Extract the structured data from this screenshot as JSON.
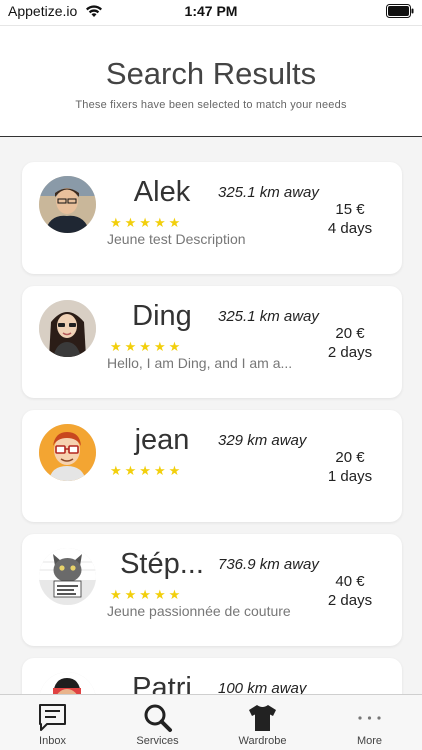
{
  "status_bar": {
    "carrier": "Appetize.io",
    "time": "1:47 PM"
  },
  "header": {
    "title": "Search Results",
    "subtitle": "These fixers have been selected to match your needs"
  },
  "results": [
    {
      "name": "Alek",
      "distance": "325.1 km away",
      "rating": "★★★★★",
      "description": "Jeune test Description",
      "price": "15 €",
      "duration": "4 days",
      "avatar_icon": "man-portrait-icon"
    },
    {
      "name": "Ding",
      "distance": "325.1 km away",
      "rating": "★★★★★",
      "description": "Hello, I am Ding, and  I am a...",
      "price": "20 €",
      "duration": "2 days",
      "avatar_icon": "woman-portrait-icon"
    },
    {
      "name": "jean",
      "distance": "329 km away",
      "rating": "★★★★★",
      "description": "",
      "price": "20 €",
      "duration": "1 days",
      "avatar_icon": "cartoon-man-icon"
    },
    {
      "name": "Stép...",
      "distance": "736.9 km away",
      "rating": "★★★★★",
      "description": "Jeune passionnée de couture",
      "price": "40 €",
      "duration": "2 days",
      "avatar_icon": "cat-portrait-icon"
    },
    {
      "name": "Patri",
      "distance": "100 km away",
      "rating": "",
      "description": "",
      "price": "",
      "duration": "",
      "avatar_icon": "person-avatar-icon"
    }
  ],
  "tab_bar": {
    "tabs": [
      {
        "label": "Inbox",
        "icon": "inbox-icon"
      },
      {
        "label": "Services",
        "icon": "search-icon"
      },
      {
        "label": "Wardrobe",
        "icon": "tshirt-icon"
      },
      {
        "label": "More",
        "icon": "more-dots-icon"
      }
    ]
  },
  "colors": {
    "star": "#f2cf0c",
    "background_list": "#f4f4f4",
    "title_text": "#444444"
  }
}
